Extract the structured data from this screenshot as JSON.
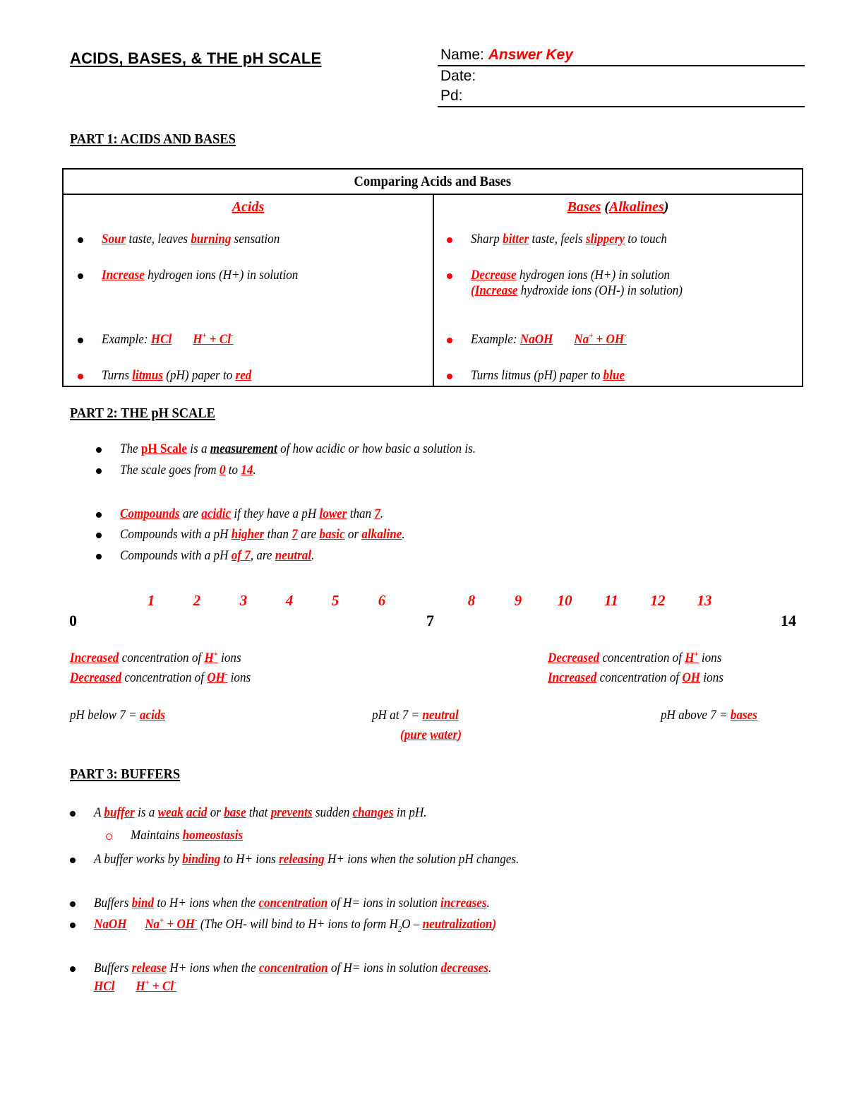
{
  "header": {
    "title": "ACIDS, BASES, & THE pH SCALE",
    "name_label": "Name:",
    "name_value": "Answer Key",
    "date_label": "Date:",
    "date_value": "",
    "pd_label": "Pd:",
    "pd_value": ""
  },
  "colors": {
    "accent_red": "#FF0000",
    "text_black": "#000000"
  },
  "part1": {
    "heading": "PART 1: ACIDS AND BASES",
    "table": {
      "title": "Comparing Acids and Bases",
      "acids_header": "Acids",
      "bases_header": "Bases (Alkalines)",
      "acids": [
        "Sour taste, leaves burning sensation",
        "Increase hydrogen ions (H+) in solution",
        "Example: HCl      H+ + Cl-",
        "Turns litmus (pH) paper to red"
      ],
      "bases": [
        "Sharp bitter taste, feels slippery to touch",
        "Decrease hydrogen ions (H+) in solution (Increase hydroxide ions (OH-) in solution)",
        "Example: NaOH      Na+ + OH-",
        "Turns litmus (pH) paper to blue"
      ]
    }
  },
  "part2": {
    "heading": "PART 2: THE pH SCALE",
    "bullets_a": [
      "The pH Scale is a measurement of how acidic or how basic a solution is.",
      "The scale goes from 0 to 14."
    ],
    "bullets_b": [
      "Compounds are acidic if they have a pH lower than 7.",
      "Compounds with a pH higher than 7 are basic or alkaline.",
      "Compounds with a pH of 7, are neutral."
    ],
    "scale": {
      "red_numbers": [
        "1",
        "2",
        "3",
        "4",
        "5",
        "6",
        "8",
        "9",
        "10",
        "11",
        "12",
        "13"
      ],
      "black_numbers": [
        "0",
        "7",
        "14"
      ]
    },
    "left_notes": [
      "Increased concentration of H+ ions",
      "Decreased concentration of OH- ions"
    ],
    "right_notes": [
      "Decreased concentration of H+ ions",
      "Increased concentration of OH- ions"
    ],
    "summary": {
      "below": "pH below 7 = acids",
      "at": "pH at 7 = neutral",
      "at_sub": "(pure water)",
      "above": "pH above 7 = bases"
    }
  },
  "part3": {
    "heading": "PART 3: BUFFERS",
    "bullets": [
      "A buffer is a weak acid or base that prevents sudden changes in pH.",
      "Maintains homeostasis",
      "A buffer works by binding to H+ ions releasing H+ ions when the solution pH changes.",
      "Buffers bind to H+ ions when the concentration of H= ions in solution increases.",
      "NaOH      Na+ + OH- (The OH- will bind to H+ ions to form H2O – neutralization)",
      "Buffers release H+ ions when the concentration of H= ions in solution decreases.",
      "HCl      H+ + Cl-"
    ]
  }
}
